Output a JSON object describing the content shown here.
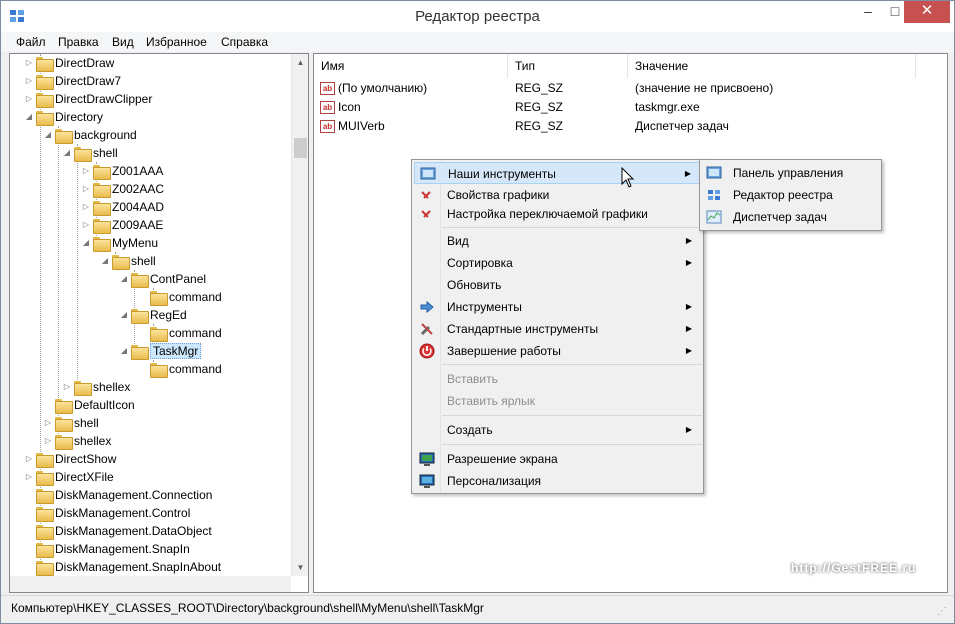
{
  "window": {
    "title": "Редактор реестра",
    "minimize": "–",
    "maximize": "□",
    "close": "✕"
  },
  "menubar": [
    "Файл",
    "Правка",
    "Вид",
    "Избранное",
    "Справка"
  ],
  "tree": {
    "items": [
      {
        "label": "DirectDraw",
        "expander": "▷"
      },
      {
        "label": "DirectDraw7",
        "expander": "▷"
      },
      {
        "label": "DirectDrawClipper",
        "expander": "▷"
      },
      {
        "label": "Directory",
        "expander": "◢"
      },
      {
        "label": "background",
        "expander": "◢"
      },
      {
        "label": "shell",
        "expander": "◢"
      },
      {
        "label": "Z001AAA",
        "expander": "▷"
      },
      {
        "label": "Z002AAC",
        "expander": "▷"
      },
      {
        "label": "Z004AAD",
        "expander": "▷"
      },
      {
        "label": "Z009AAE",
        "expander": "▷"
      },
      {
        "label": "MyMenu",
        "expander": "◢"
      },
      {
        "label": "shell",
        "expander": "◢"
      },
      {
        "label": "ContPanel",
        "expander": "◢"
      },
      {
        "label": "command",
        "expander": ""
      },
      {
        "label": "RegEd",
        "expander": "◢"
      },
      {
        "label": "command",
        "expander": ""
      },
      {
        "label": "TaskMgr",
        "expander": "◢"
      },
      {
        "label": "command",
        "expander": ""
      },
      {
        "label": "shellex",
        "expander": "▷"
      },
      {
        "label": "DefaultIcon",
        "expander": ""
      },
      {
        "label": "shell",
        "expander": "▷"
      },
      {
        "label": "shellex",
        "expander": "▷"
      },
      {
        "label": "DirectShow",
        "expander": "▷"
      },
      {
        "label": "DirectXFile",
        "expander": "▷"
      },
      {
        "label": "DiskManagement.Connection",
        "expander": ""
      },
      {
        "label": "DiskManagement.Control",
        "expander": ""
      },
      {
        "label": "DiskManagement.DataObject",
        "expander": ""
      },
      {
        "label": "DiskManagement.SnapIn",
        "expander": ""
      },
      {
        "label": "DiskManagement.SnapInAbout",
        "expander": ""
      }
    ],
    "selected": "TaskMgr"
  },
  "values_pane": {
    "columns": [
      "Имя",
      "Тип",
      "Значение"
    ],
    "rows": [
      {
        "name": "(По умолчанию)",
        "type": "REG_SZ",
        "value": "(значение не присвоено)"
      },
      {
        "name": "Icon",
        "type": "REG_SZ",
        "value": "taskmgr.exe"
      },
      {
        "name": "MUIVerb",
        "type": "REG_SZ",
        "value": "Диспетчер задач"
      }
    ],
    "icon_text": "ab"
  },
  "context_menu": {
    "items": [
      {
        "label": "Наши инструменты",
        "submenu": true,
        "icon": "tools-panel-icon",
        "highlighted": true
      },
      {
        "label": "Свойства графики",
        "submenu": false,
        "icon": "graphics-icon"
      },
      {
        "label": "Настройка переключаемой графики",
        "submenu": false,
        "icon": "graphics-switch-icon"
      },
      {
        "label": "Вид",
        "submenu": true
      },
      {
        "label": "Сортировка",
        "submenu": true
      },
      {
        "label": "Обновить",
        "submenu": false
      },
      {
        "label": "Инструменты",
        "submenu": true,
        "icon": "arrow-tools-icon"
      },
      {
        "label": "Стандартные инструменты",
        "submenu": true,
        "icon": "wrench-icon"
      },
      {
        "label": "Завершение работы",
        "submenu": true,
        "icon": "power-icon"
      },
      {
        "label": "Вставить",
        "disabled": true
      },
      {
        "label": "Вставить ярлык",
        "disabled": true
      },
      {
        "label": "Создать",
        "submenu": true
      },
      {
        "label": "Разрешение экрана",
        "submenu": false,
        "icon": "display-icon"
      },
      {
        "label": "Персонализация",
        "submenu": false,
        "icon": "personalize-icon"
      }
    ],
    "submenu_arrow": "▶"
  },
  "submenu": {
    "items": [
      {
        "label": "Панель управления",
        "icon": "control-panel-icon"
      },
      {
        "label": "Редактор реестра",
        "icon": "regedit-icon"
      },
      {
        "label": "Диспетчер задач",
        "icon": "task-manager-icon"
      }
    ]
  },
  "statusbar": {
    "path": "Компьютер\\HKEY_CLASSES_ROOT\\Directory\\background\\shell\\MyMenu\\shell\\TaskMgr"
  },
  "watermark": "http://GestFREE.ru",
  "colors": {
    "accent": "#cce8ff",
    "menu_highlight": "#d5e7f8",
    "close_button": "#c75050"
  }
}
